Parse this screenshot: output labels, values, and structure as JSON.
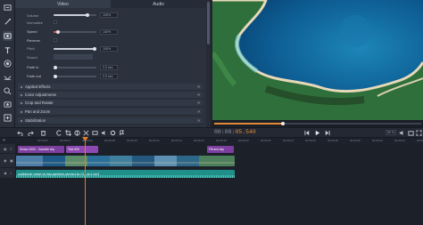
{
  "tabs": {
    "video": "Video",
    "audio": "Audio"
  },
  "props": {
    "volume": {
      "label": "Volume",
      "value": "100%"
    },
    "normalize": {
      "label": "Normalize"
    },
    "speed": {
      "label": "Speed",
      "value": "100%"
    },
    "reverse": {
      "label": "Reverse"
    },
    "pitch": {
      "label": "Pitch",
      "value": "100%"
    },
    "sound": {
      "label": "Sound"
    },
    "fade_in": {
      "label": "Fade in",
      "value": "0.0 sec"
    },
    "fade_out": {
      "label": "Fade out",
      "value": "0.0 sec"
    }
  },
  "sections": [
    "Applied Effects",
    "Color Adjustments",
    "Crop and Rotate",
    "Pan and Zoom",
    "Stabilization"
  ],
  "timecode": {
    "prefix": "00:00:",
    "current": "05.540"
  },
  "zoom": "50 %",
  "ruler_ticks": [
    "00:00:02",
    "00:00:04",
    "00:00:06",
    "00:00:08",
    "00:00:10",
    "00:00:12",
    "00:00:14",
    "00:00:16",
    "00:00:18",
    "00:00:20",
    "00:00:22",
    "00:00:24",
    "00:00:26",
    "00:00:28",
    "00:00:30",
    "00:00:32",
    "00:00:34",
    "00:00:36"
  ],
  "clips": {
    "title1": "Sintac 0000 - Ganette sky",
    "title2": "Text 000",
    "title3": "Fill and sky",
    "audio": "audioblock sdmpl sd-hdg-agisthpiy-gtvmsvl-by-01-t-at-4.mp3"
  },
  "colors": {
    "accent": "#e58a38",
    "title_clip": "#7c3fa0",
    "audio_clip": "#1f8f8a",
    "video_clip": "#2f5d86"
  },
  "seek_progress": 0.33
}
